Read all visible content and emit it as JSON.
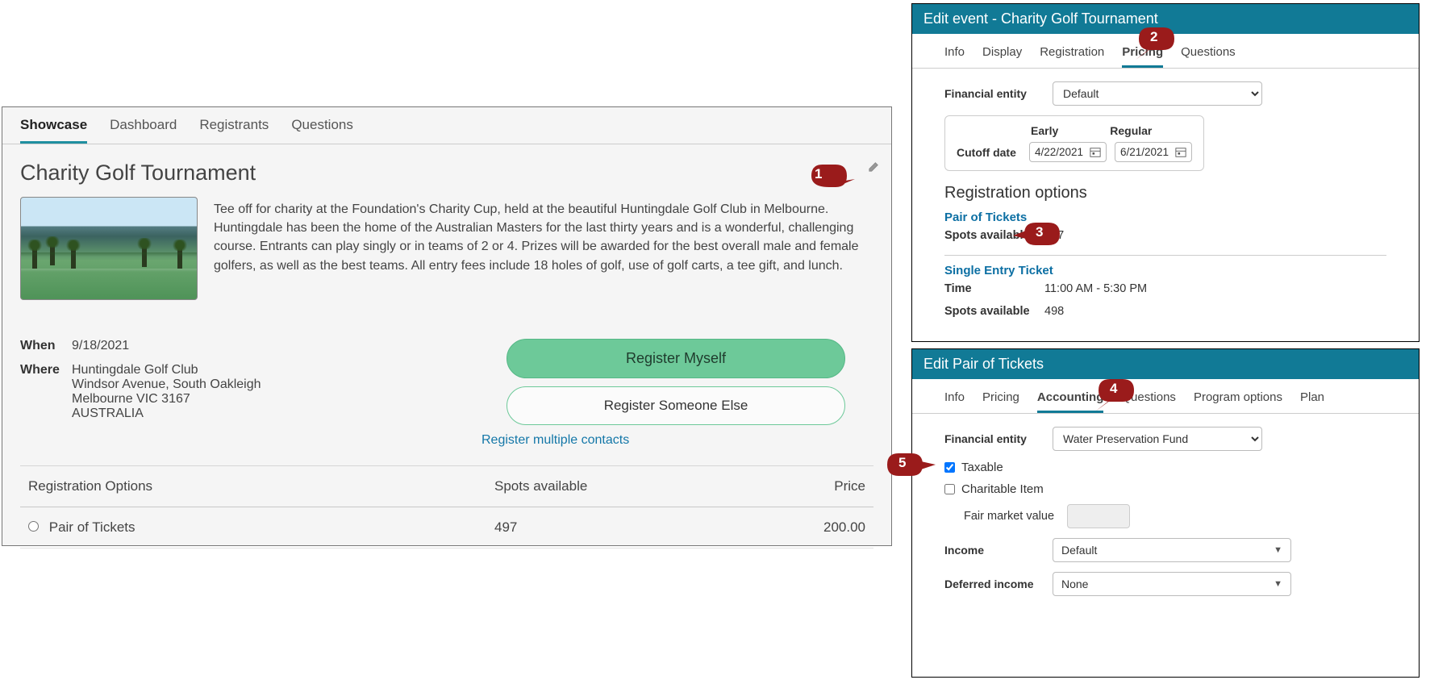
{
  "left": {
    "tabs": [
      "Showcase",
      "Dashboard",
      "Registrants",
      "Questions"
    ],
    "activeTab": 0,
    "title": "Charity Golf Tournament",
    "description": "Tee off for charity at the Foundation's Charity Cup, held at the beautiful Huntingdale Golf Club in Melbourne. Huntingdale has been the home of the Australian Masters for the last thirty years and is a wonderful, challenging course. Entrants can play singly or in teams of 2 or 4. Prizes will be awarded for the best overall male and female golfers, as well as the best teams. All entry fees include 18 holes of golf, use of golf carts, a tee gift, and lunch.",
    "when_label": "When",
    "when_value": "9/18/2021",
    "where_label": "Where",
    "where_lines": [
      "Huntingdale Golf Club",
      "Windsor Avenue, South Oakleigh",
      "Melbourne VIC 3167",
      "AUSTRALIA"
    ],
    "btn_primary": "Register Myself",
    "btn_secondary": "Register Someone Else",
    "multi_link": "Register multiple contacts",
    "table": {
      "headers": [
        "Registration Options",
        "Spots available",
        "Price"
      ],
      "rows": [
        {
          "name": "Pair of Tickets",
          "spots": "497",
          "price": "200.00"
        }
      ]
    }
  },
  "editEvent": {
    "header": "Edit event - Charity Golf Tournament",
    "tabs": [
      "Info",
      "Display",
      "Registration",
      "Pricing",
      "Questions"
    ],
    "activeTab": 3,
    "financial_entity_label": "Financial entity",
    "financial_entity_value": "Default",
    "cutoff": {
      "row_label": "Cutoff date",
      "cols": [
        "Early",
        "Regular"
      ],
      "early": "4/22/2021",
      "regular": "6/21/2021"
    },
    "reg_options_title": "Registration options",
    "options": [
      {
        "name": "Pair of Tickets",
        "fields": [
          {
            "k": "Spots available",
            "v": "497"
          }
        ]
      },
      {
        "name": "Single Entry Ticket",
        "fields": [
          {
            "k": "Time",
            "v": "11:00 AM - 5:30 PM"
          },
          {
            "k": "Spots available",
            "v": "498"
          }
        ]
      }
    ]
  },
  "editPair": {
    "header": "Edit Pair of Tickets",
    "tabs": [
      "Info",
      "Pricing",
      "Accounting",
      "Questions",
      "Program options",
      "Plan"
    ],
    "activeTab": 2,
    "financial_entity_label": "Financial entity",
    "financial_entity_value": "Water Preservation Fund",
    "taxable_label": "Taxable",
    "taxable_checked": true,
    "charitable_label": "Charitable Item",
    "charitable_checked": false,
    "fmv_label": "Fair market value",
    "income_label": "Income",
    "income_value": "Default",
    "deferred_label": "Deferred income",
    "deferred_value": "None"
  },
  "callouts": [
    "1",
    "2",
    "3",
    "4",
    "5"
  ]
}
